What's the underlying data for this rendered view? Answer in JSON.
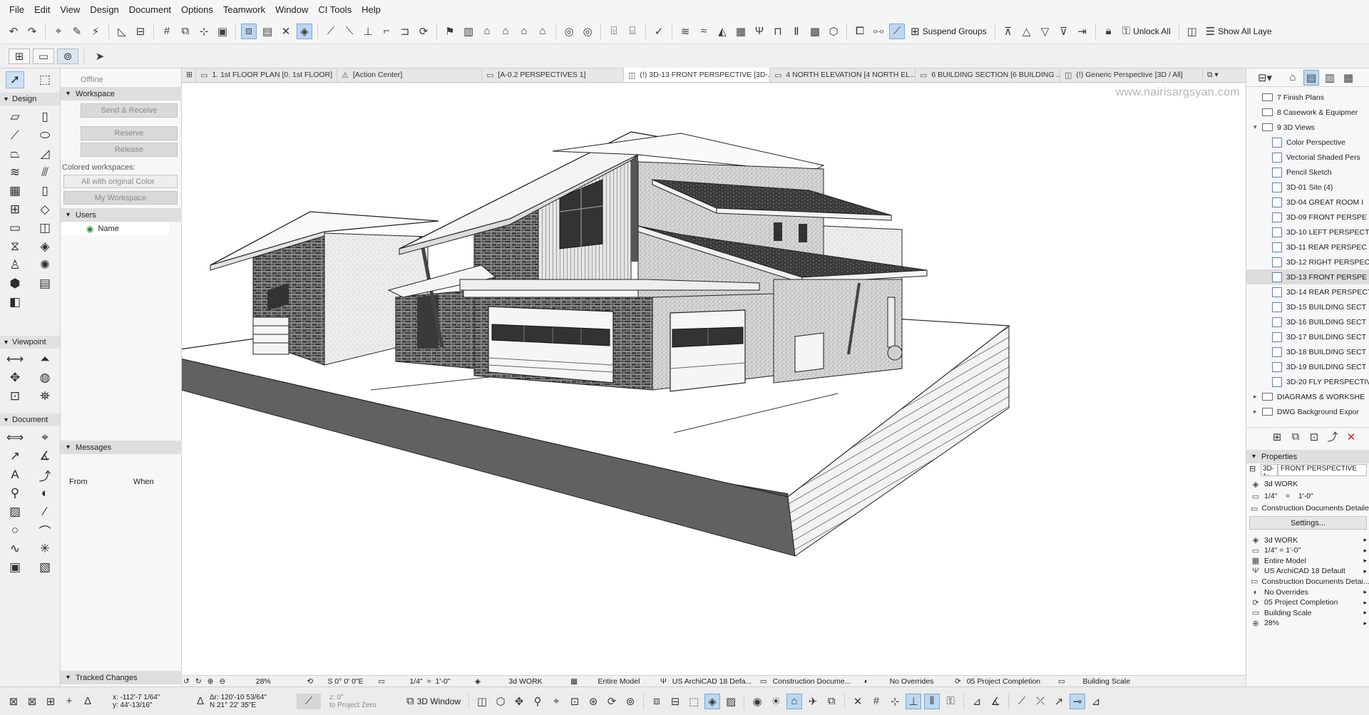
{
  "menu": [
    "File",
    "Edit",
    "View",
    "Design",
    "Document",
    "Options",
    "Teamwork",
    "Window",
    "CI Tools",
    "Help"
  ],
  "toolbar": {
    "suspend_groups": "Suspend Groups",
    "unlock_all": "Unlock All",
    "show_all_layers": "Show All Laye"
  },
  "toolbox": {
    "sections": {
      "design": "Design",
      "viewpoint": "Viewpoint",
      "document": "Document"
    }
  },
  "teamwork": {
    "status": "Offline",
    "workspace_header": "Workspace",
    "send_receive": "Send & Receive",
    "reserve": "Reserve",
    "release": "Release",
    "colored_workspaces": "Colored workspaces:",
    "color_select": "All with original Color",
    "my_workspace": "My Workspace",
    "users_header": "Users",
    "user_col": "Name",
    "messages_header": "Messages",
    "col_from": "From",
    "col_when": "When",
    "tracked_changes": "Tracked Changes"
  },
  "tabs": [
    {
      "label": "1. 1st FLOOR PLAN [0. 1st FLOOR]",
      "active": false
    },
    {
      "label": "[Action Center]",
      "active": false
    },
    {
      "label": "[A-0.2 PERSPECTIVES 1]",
      "active": false
    },
    {
      "label": "(!) 3D-13 FRONT PERSPECTIVE [3D-...",
      "active": true
    },
    {
      "label": "4 NORTH ELEVATION [4 NORTH EL...",
      "active": false
    },
    {
      "label": "6 BUILDING SECTION [6 BUILDING ...",
      "active": false
    },
    {
      "label": "(!) Generic Perspective [3D / All]",
      "active": false
    }
  ],
  "viewport": {
    "watermark": "www.nairisargsyan.com"
  },
  "status_bar": {
    "zoom": "28%",
    "angle": "S 0° 0' 0\"E",
    "scale_a": "1/4\"",
    "scale_eq": "=",
    "scale_b": "1'-0\"",
    "layer_combo": "3d WORK",
    "model_view": "Entire Model",
    "pen_set": "US ArchiCAD 18 Defa...",
    "mvo": "Construction Docume...",
    "overrides": "No Overrides",
    "renovation": "05 Project Completion",
    "structure": "Building Scale"
  },
  "bottom_bar": {
    "x": "x: -112'-7 1/64\"",
    "y": "y: 44'-13/16\"",
    "dr": "Δr: 120'-10 53/64\"",
    "angle": "N 21° 22' 35\"E",
    "z": "z: 0\"",
    "to_project_zero": "to Project Zero",
    "window3d": "3D Window"
  },
  "navigator": {
    "items": [
      {
        "label": "7 Finish Plans",
        "type": "folder",
        "indent": 1
      },
      {
        "label": "8 Casework & Equipmer",
        "type": "folder",
        "indent": 1
      },
      {
        "label": "9 3D Views",
        "type": "folder-open",
        "indent": 1
      },
      {
        "label": "Color Perspective",
        "type": "view",
        "indent": 2
      },
      {
        "label": "Vectorial Shaded Pers",
        "type": "view",
        "indent": 2
      },
      {
        "label": "Pencil Sketch",
        "type": "view",
        "indent": 2
      },
      {
        "label": "3D-01 Site (4)",
        "type": "view",
        "indent": 2
      },
      {
        "label": "3D-04 GREAT ROOM I",
        "type": "view",
        "indent": 2
      },
      {
        "label": "3D-09 FRONT PERSPE",
        "type": "view",
        "indent": 2
      },
      {
        "label": "3D-10 LEFT PERSPECT",
        "type": "view",
        "indent": 2
      },
      {
        "label": "3D-11 REAR PERSPEC",
        "type": "view",
        "indent": 2
      },
      {
        "label": "3D-12 RIGHT PERSPEC",
        "type": "view",
        "indent": 2
      },
      {
        "label": "3D-13 FRONT PERSPE",
        "type": "view",
        "indent": 2,
        "selected": true
      },
      {
        "label": "3D-14 REAR PERSPECT",
        "type": "view",
        "indent": 2
      },
      {
        "label": "3D-15 BUILDING SECT",
        "type": "view",
        "indent": 2
      },
      {
        "label": "3D-16 BUILDING SECT",
        "type": "view",
        "indent": 2
      },
      {
        "label": "3D-17 BUILDING SECT",
        "type": "view",
        "indent": 2
      },
      {
        "label": "3D-18 BUILDING SECT",
        "type": "view",
        "indent": 2
      },
      {
        "label": "3D-19 BUILDING SECT",
        "type": "view",
        "indent": 2
      },
      {
        "label": "3D-20 FLY PERSPECTIV",
        "type": "view",
        "indent": 2
      },
      {
        "label": "DIAGRAMS & WORKSHE",
        "type": "folder",
        "indent": 1
      },
      {
        "label": "DWG Background Expor",
        "type": "folder",
        "indent": 1
      }
    ],
    "properties_header": "Properties",
    "prop_id": "3D-1:",
    "prop_name": "FRONT PERSPECTIVE",
    "layer": "3d WORK",
    "scale_a": "1/4\"",
    "scale_eq": "=",
    "scale_b": "1'-0\"",
    "mvo": "Construction Documents Detailed",
    "settings": "Settings...",
    "props": [
      "3d WORK",
      "1/4\"    =    1'-0\"",
      "Entire Model",
      "US ArchiCAD 18 Default",
      "Construction Documents Detai...",
      "No Overrides",
      "05 Project Completion",
      "Building Scale",
      "28%"
    ]
  }
}
